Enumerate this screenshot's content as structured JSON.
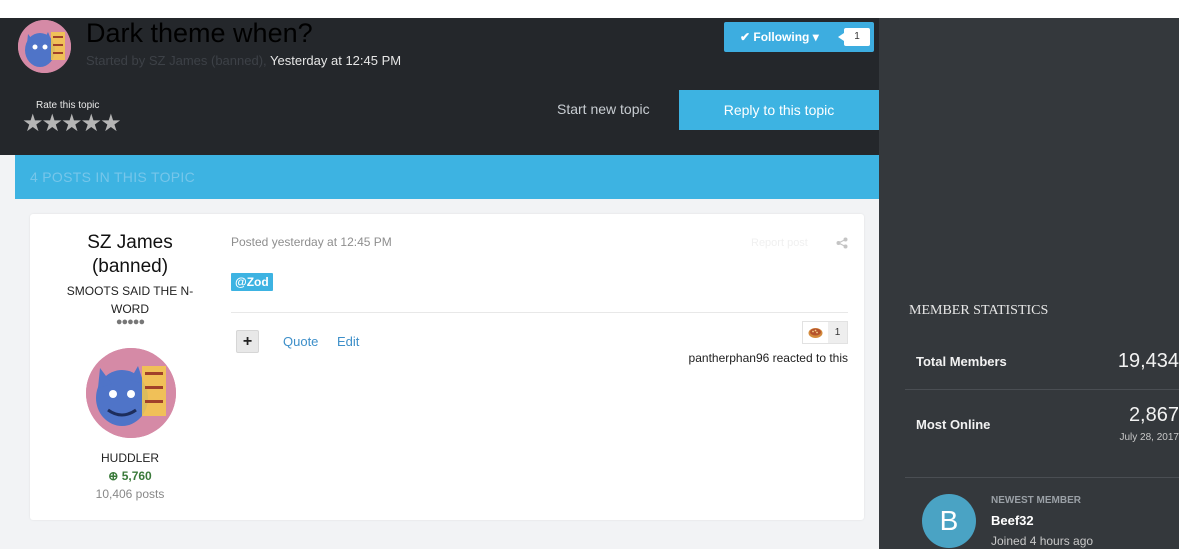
{
  "topic": {
    "title": "Dark theme when?",
    "started_by": "Started by SZ James (banned),",
    "started_time": "Yesterday at 12:45 PM",
    "rate_label": "Rate this topic",
    "stars": "★★★★★"
  },
  "follow": {
    "label": "✔ Following ▾",
    "count": "1"
  },
  "actions": {
    "start_new_topic": "Start new topic",
    "reply": "Reply to this topic"
  },
  "posts_bar": {
    "label": "4 POSTS IN THIS TOPIC"
  },
  "post": {
    "author_name": "SZ James (banned)",
    "author_title": "SMOOTS SAID THE N-WORD",
    "author_pips": "●●●●●",
    "author_group": "HUDDLER",
    "author_rep": "5,760",
    "author_posts": "10,406 posts",
    "posted": "Posted yesterday at 12:45 PM",
    "report": "Report post",
    "mention": "@Zod",
    "plus": "+",
    "quote": "Quote",
    "edit": "Edit",
    "reaction_count": "1",
    "reacted_by": "pantherphan96 reacted to this"
  },
  "sidebar": {
    "title": "MEMBER STATISTICS",
    "total_members_label": "Total Members",
    "total_members_value": "19,434",
    "most_online_label": "Most Online",
    "most_online_value": "2,867",
    "most_online_date": "July 28, 2017",
    "newest_label": "NEWEST MEMBER",
    "newest_initial": "B",
    "newest_name": "Beef32",
    "newest_joined": "Joined 4 hours ago"
  },
  "colors": {
    "accent": "#3db3e2",
    "header_dark": "#24272b",
    "sidebar_dark": "#34383c"
  }
}
